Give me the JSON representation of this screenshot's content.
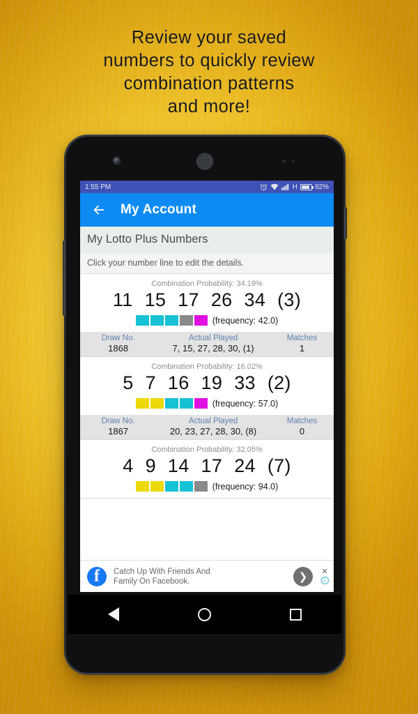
{
  "promo": {
    "headline_lines": [
      "Review your saved",
      "numbers to quickly review",
      "combination patterns",
      "and more!"
    ]
  },
  "statusbar": {
    "time": "1:55 PM",
    "alarm_icon": "alarm-clock-icon",
    "wifi_icon": "wifi-icon",
    "signal_icon": "cellular-signal-icon",
    "network_type": "H",
    "battery_icon": "battery-icon",
    "battery_level": "92%"
  },
  "appbar": {
    "back_icon": "back-arrow-icon",
    "title": "My Account"
  },
  "section": {
    "header": "My Lotto Plus Numbers",
    "hint": "Click your number line to edit the details."
  },
  "table_headers": {
    "draw": "Draw No.",
    "played": "Actual Played",
    "matches": "Matches"
  },
  "colors": {
    "accent_blue": "#0d8bf2",
    "statusbar_blue": "#3f51b5",
    "cyan": "#17c1d6",
    "yellow": "#ebd90a",
    "gray": "#8a8a8a",
    "magenta": "#e010e0",
    "header_label_blue": "#5f81ad",
    "table_band": "#e3e3e3"
  },
  "cards": [
    {
      "probability_label": "Combination Probability: 34.19%",
      "numbers": [
        "11",
        "15",
        "17",
        "26",
        "34"
      ],
      "bonus": "(3)",
      "swatches": [
        "#17c1d6",
        "#17c1d6",
        "#17c1d6",
        "#8a8a8a",
        "#e010e0"
      ],
      "frequency_label": "(frequency: 42.0)",
      "draw_no": "1868",
      "actual_played": "7, 15, 27, 28, 30, (1)",
      "matches": "1"
    },
    {
      "probability_label": "Combination Probability: 16.02%",
      "numbers": [
        "5",
        "7",
        "16",
        "19",
        "33"
      ],
      "bonus": "(2)",
      "swatches": [
        "#ebd90a",
        "#ebd90a",
        "#17c1d6",
        "#17c1d6",
        "#e010e0"
      ],
      "frequency_label": "(frequency: 57.0)",
      "draw_no": "1867",
      "actual_played": "20, 23, 27, 28, 30, (8)",
      "matches": "0"
    },
    {
      "probability_label": "Combination Probability: 32.05%",
      "numbers": [
        "4",
        "9",
        "14",
        "17",
        "24"
      ],
      "bonus": "(7)",
      "swatches": [
        "#ebd90a",
        "#ebd90a",
        "#17c1d6",
        "#17c1d6",
        "#8a8a8a"
      ],
      "frequency_label": "(frequency: 94.0)",
      "draw_no": "",
      "actual_played": "",
      "matches": ""
    }
  ],
  "ad": {
    "brand_icon": "facebook-logo-icon",
    "line1": "Catch Up With Friends And",
    "line2": "Family On Facebook.",
    "cta_icon": "chevron-right-icon",
    "close_label": "✕",
    "info_label": "i"
  },
  "navbar": {
    "back": "nav-back-icon",
    "home": "nav-home-icon",
    "recents": "nav-recents-icon"
  }
}
